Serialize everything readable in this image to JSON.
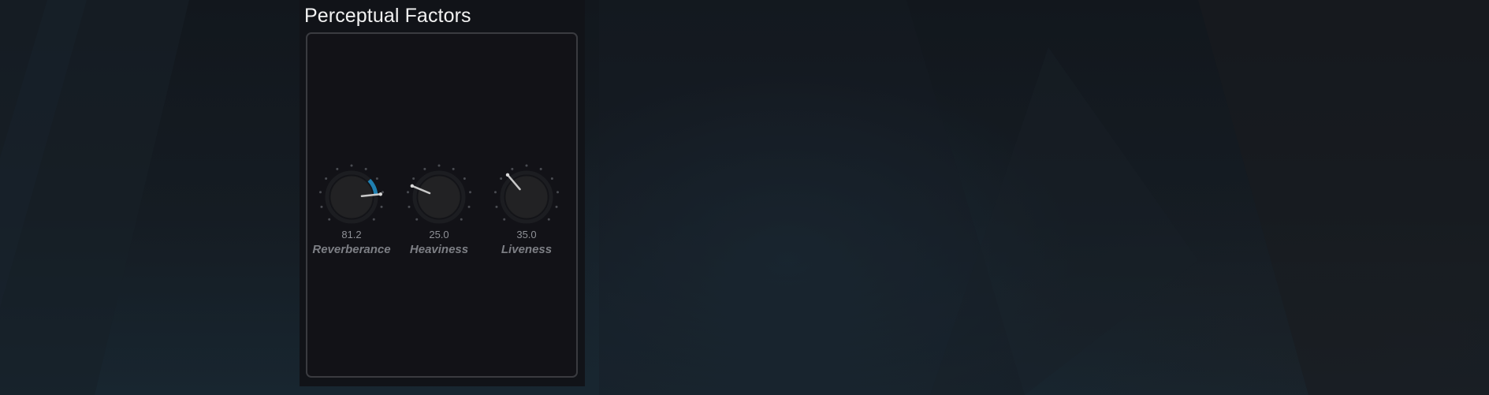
{
  "panel": {
    "title": "Perceptual Factors"
  },
  "knobs": [
    {
      "id": "reverberance",
      "label": "Reverberance",
      "value_text": "81.2",
      "level_fraction": 0.812,
      "active": true
    },
    {
      "id": "heaviness",
      "label": "Heaviness",
      "value_text": "25.0",
      "level_fraction": 0.25,
      "active": false
    },
    {
      "id": "liveness",
      "label": "Liveness",
      "value_text": "35.0",
      "level_fraction": 0.35,
      "active": false
    }
  ],
  "colors": {
    "accent": "#1f7fb0",
    "background": "#141a21",
    "panel": "#111318",
    "knob_body": "#222224",
    "pointer": "#c9c9c9",
    "label": "#7d7f85"
  }
}
